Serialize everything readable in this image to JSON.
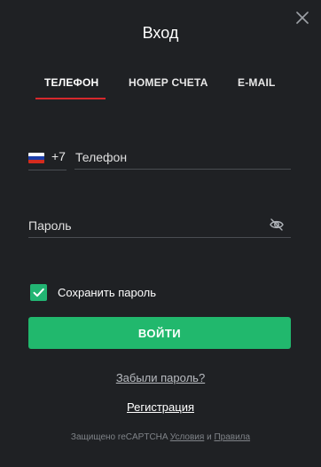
{
  "modal": {
    "title": "Вход",
    "close_icon": "close-icon"
  },
  "tabs": [
    {
      "label": "ТЕЛЕФОН",
      "active": true
    },
    {
      "label": "НОМЕР СЧЕТА",
      "active": false
    },
    {
      "label": "E-MAIL",
      "active": false
    }
  ],
  "phone": {
    "country_flag": "russia-flag-icon",
    "country_code": "+7",
    "placeholder": "Телефон",
    "value": ""
  },
  "password": {
    "placeholder": "Пароль",
    "value": "",
    "toggle_icon": "eye-off-icon"
  },
  "remember": {
    "label": "Сохранить пароль",
    "checked": true
  },
  "login_button": {
    "label": "ВОЙТИ"
  },
  "forgot_link": {
    "label": "Забыли пароль?"
  },
  "register_link": {
    "label": "Регистрация"
  },
  "captcha": {
    "prefix": "Защищено reCAPTCHA",
    "terms": "Условия",
    "and": "и",
    "privacy": "Правила"
  },
  "colors": {
    "background": "#1f2124",
    "accent_green": "#21b86d",
    "tab_underline": "#d6282c",
    "divider": "#4a4d52"
  }
}
